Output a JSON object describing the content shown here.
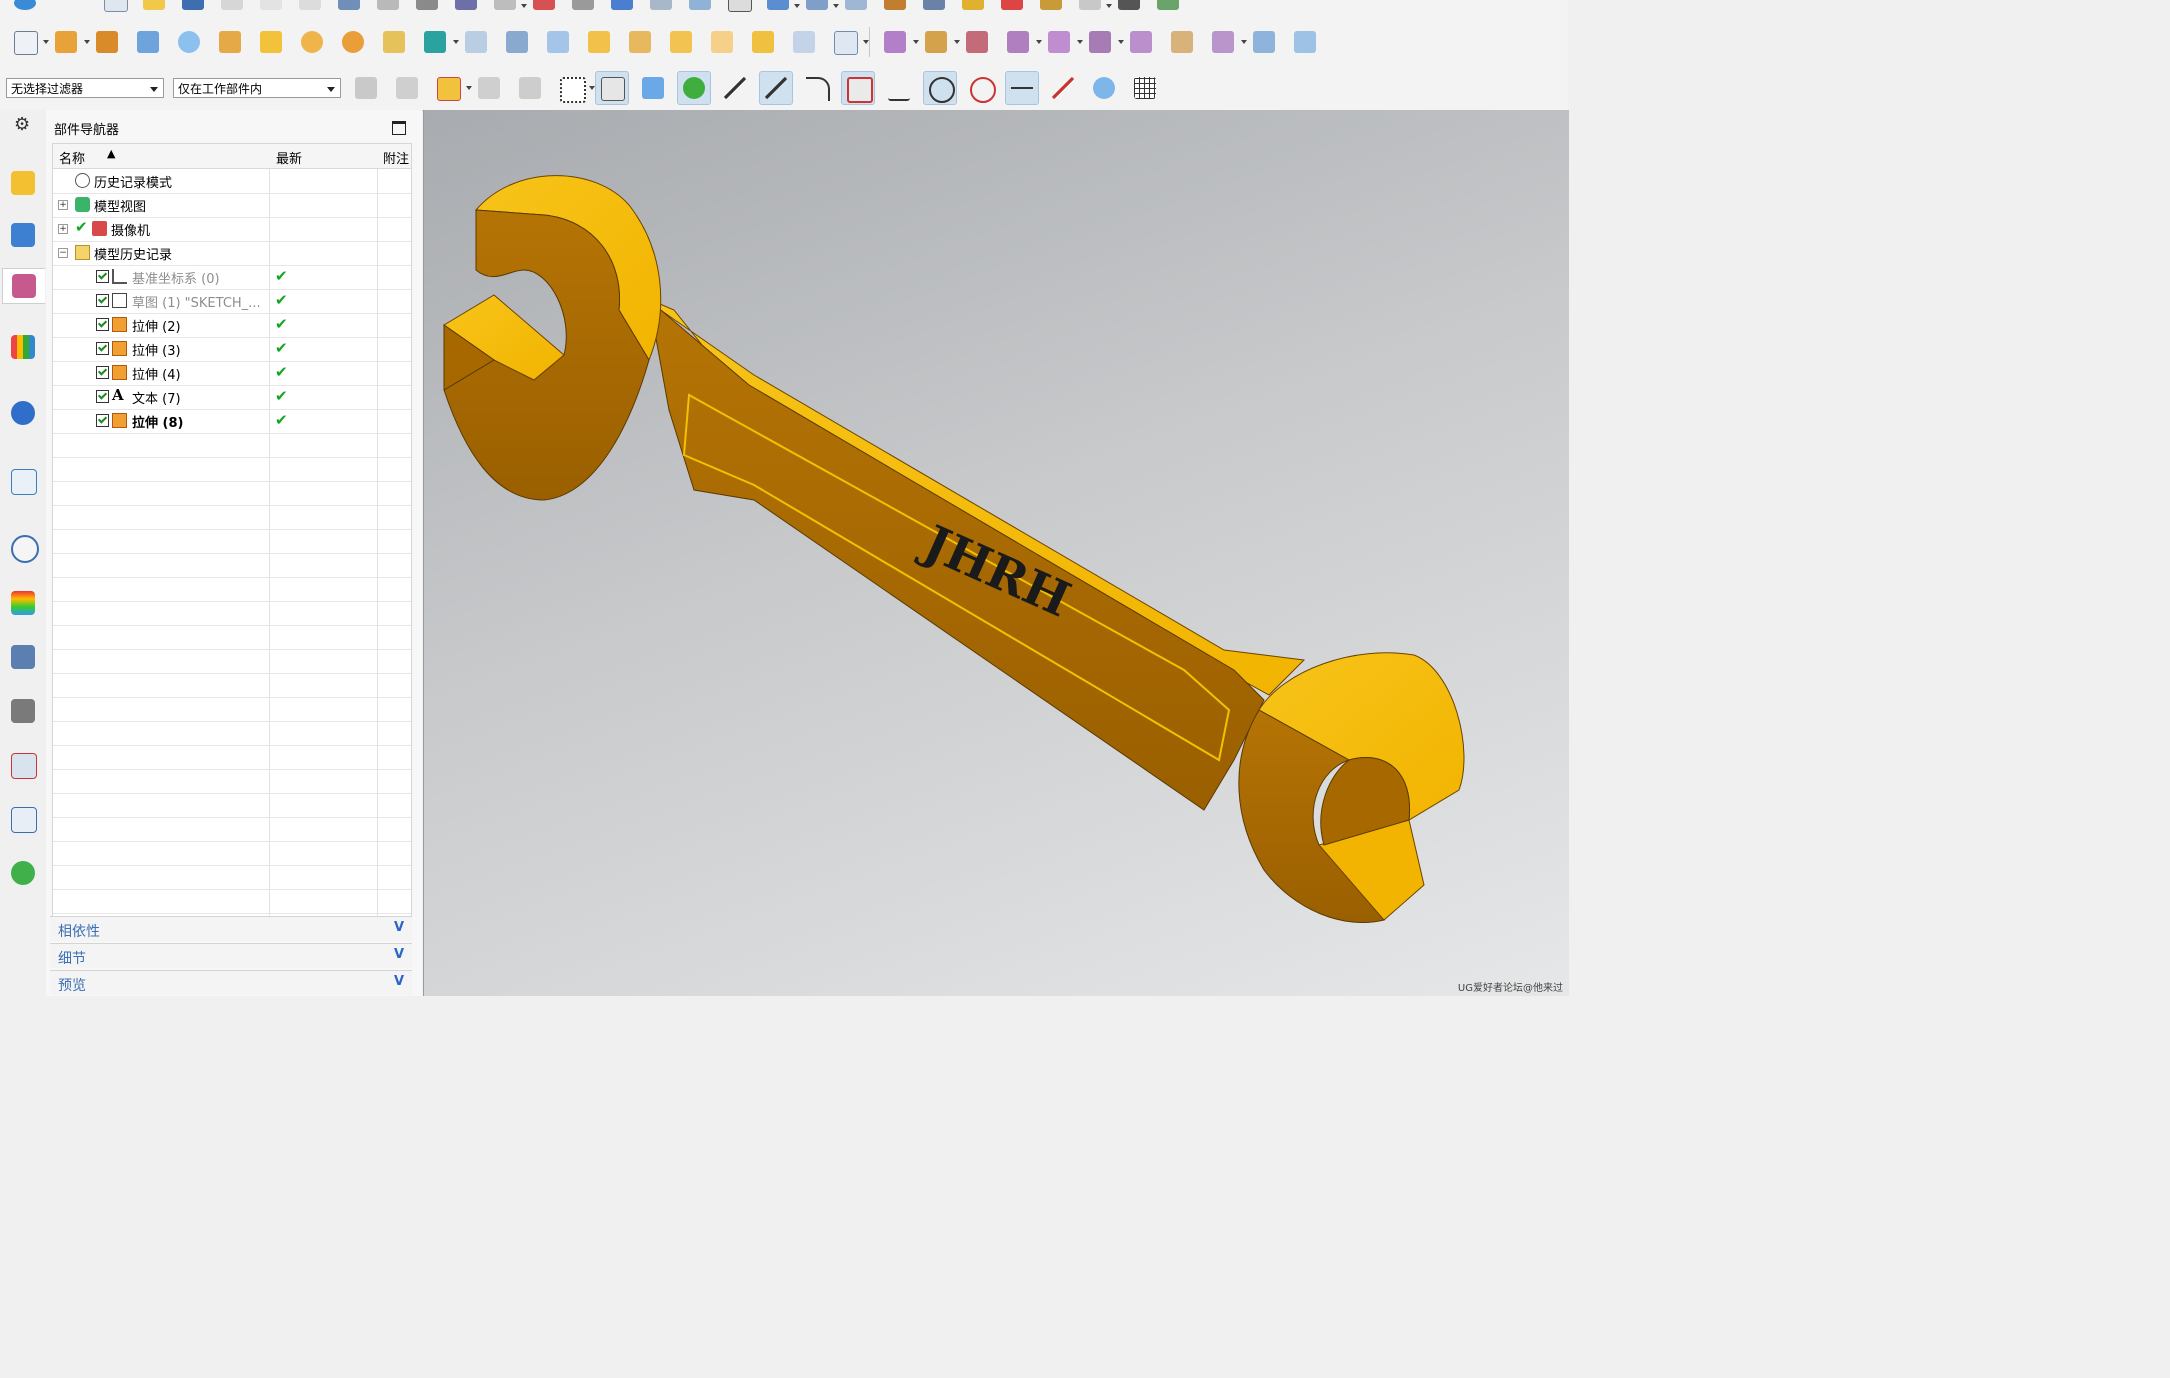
{
  "filters": {
    "selection_filter": "无选择过滤器",
    "scope": "仅在工作部件内"
  },
  "navigator": {
    "title": "部件导航器",
    "columns": {
      "name": "名称",
      "latest": "最新",
      "notes": "附注"
    },
    "rows": [
      {
        "label": "历史记录模式",
        "icon": "clock-icon"
      },
      {
        "label": "模型视图",
        "icon": "model-views-icon"
      },
      {
        "label": "摄像机",
        "icon": "camera-icon"
      },
      {
        "label": "模型历史记录",
        "icon": "folder-icon"
      },
      {
        "label": "基准坐标系 (0)",
        "icon": "datum-csys-icon",
        "latest": "✔"
      },
      {
        "label": "草图 (1) \"SKETCH_...",
        "icon": "sketch-icon",
        "latest": "✔"
      },
      {
        "label": "拉伸 (2)",
        "icon": "extrude-icon",
        "latest": "✔"
      },
      {
        "label": "拉伸 (3)",
        "icon": "extrude-icon",
        "latest": "✔"
      },
      {
        "label": "拉伸 (4)",
        "icon": "extrude-icon",
        "latest": "✔"
      },
      {
        "label": "文本 (7)",
        "icon": "text-feature-icon",
        "latest": "✔"
      },
      {
        "label": "拉伸 (8)",
        "icon": "extrude-icon",
        "latest": "✔"
      }
    ],
    "sections": [
      "相依性",
      "细节",
      "预览"
    ]
  },
  "model": {
    "engraved_text": "JHRH",
    "body_color": "#f2b400",
    "shade_color": "#a86800"
  },
  "watermark": "UG爱好者论坛@他来过"
}
